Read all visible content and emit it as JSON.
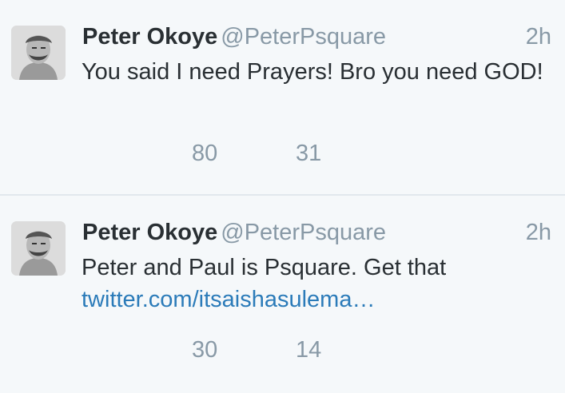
{
  "tweets": [
    {
      "author_name": "Peter Okoye",
      "author_handle": "@PeterPsquare",
      "time": "2h",
      "text": "You said I need Prayers! Bro you need GOD!",
      "link": "",
      "retweets": "80",
      "likes": "31"
    },
    {
      "author_name": "Peter Okoye",
      "author_handle": "@PeterPsquare",
      "time": "2h",
      "text": "Peter and Paul is Psquare. Get that",
      "link": "twitter.com/itsaishasulema…",
      "retweets": "30",
      "likes": "14"
    }
  ],
  "colors": {
    "background": "#f5f8fa",
    "name": "#292f33",
    "muted": "#8899a6",
    "link": "#2b7bb9",
    "divider": "#e1e8ed"
  },
  "icons": {
    "avatar": "avatar-icon"
  }
}
